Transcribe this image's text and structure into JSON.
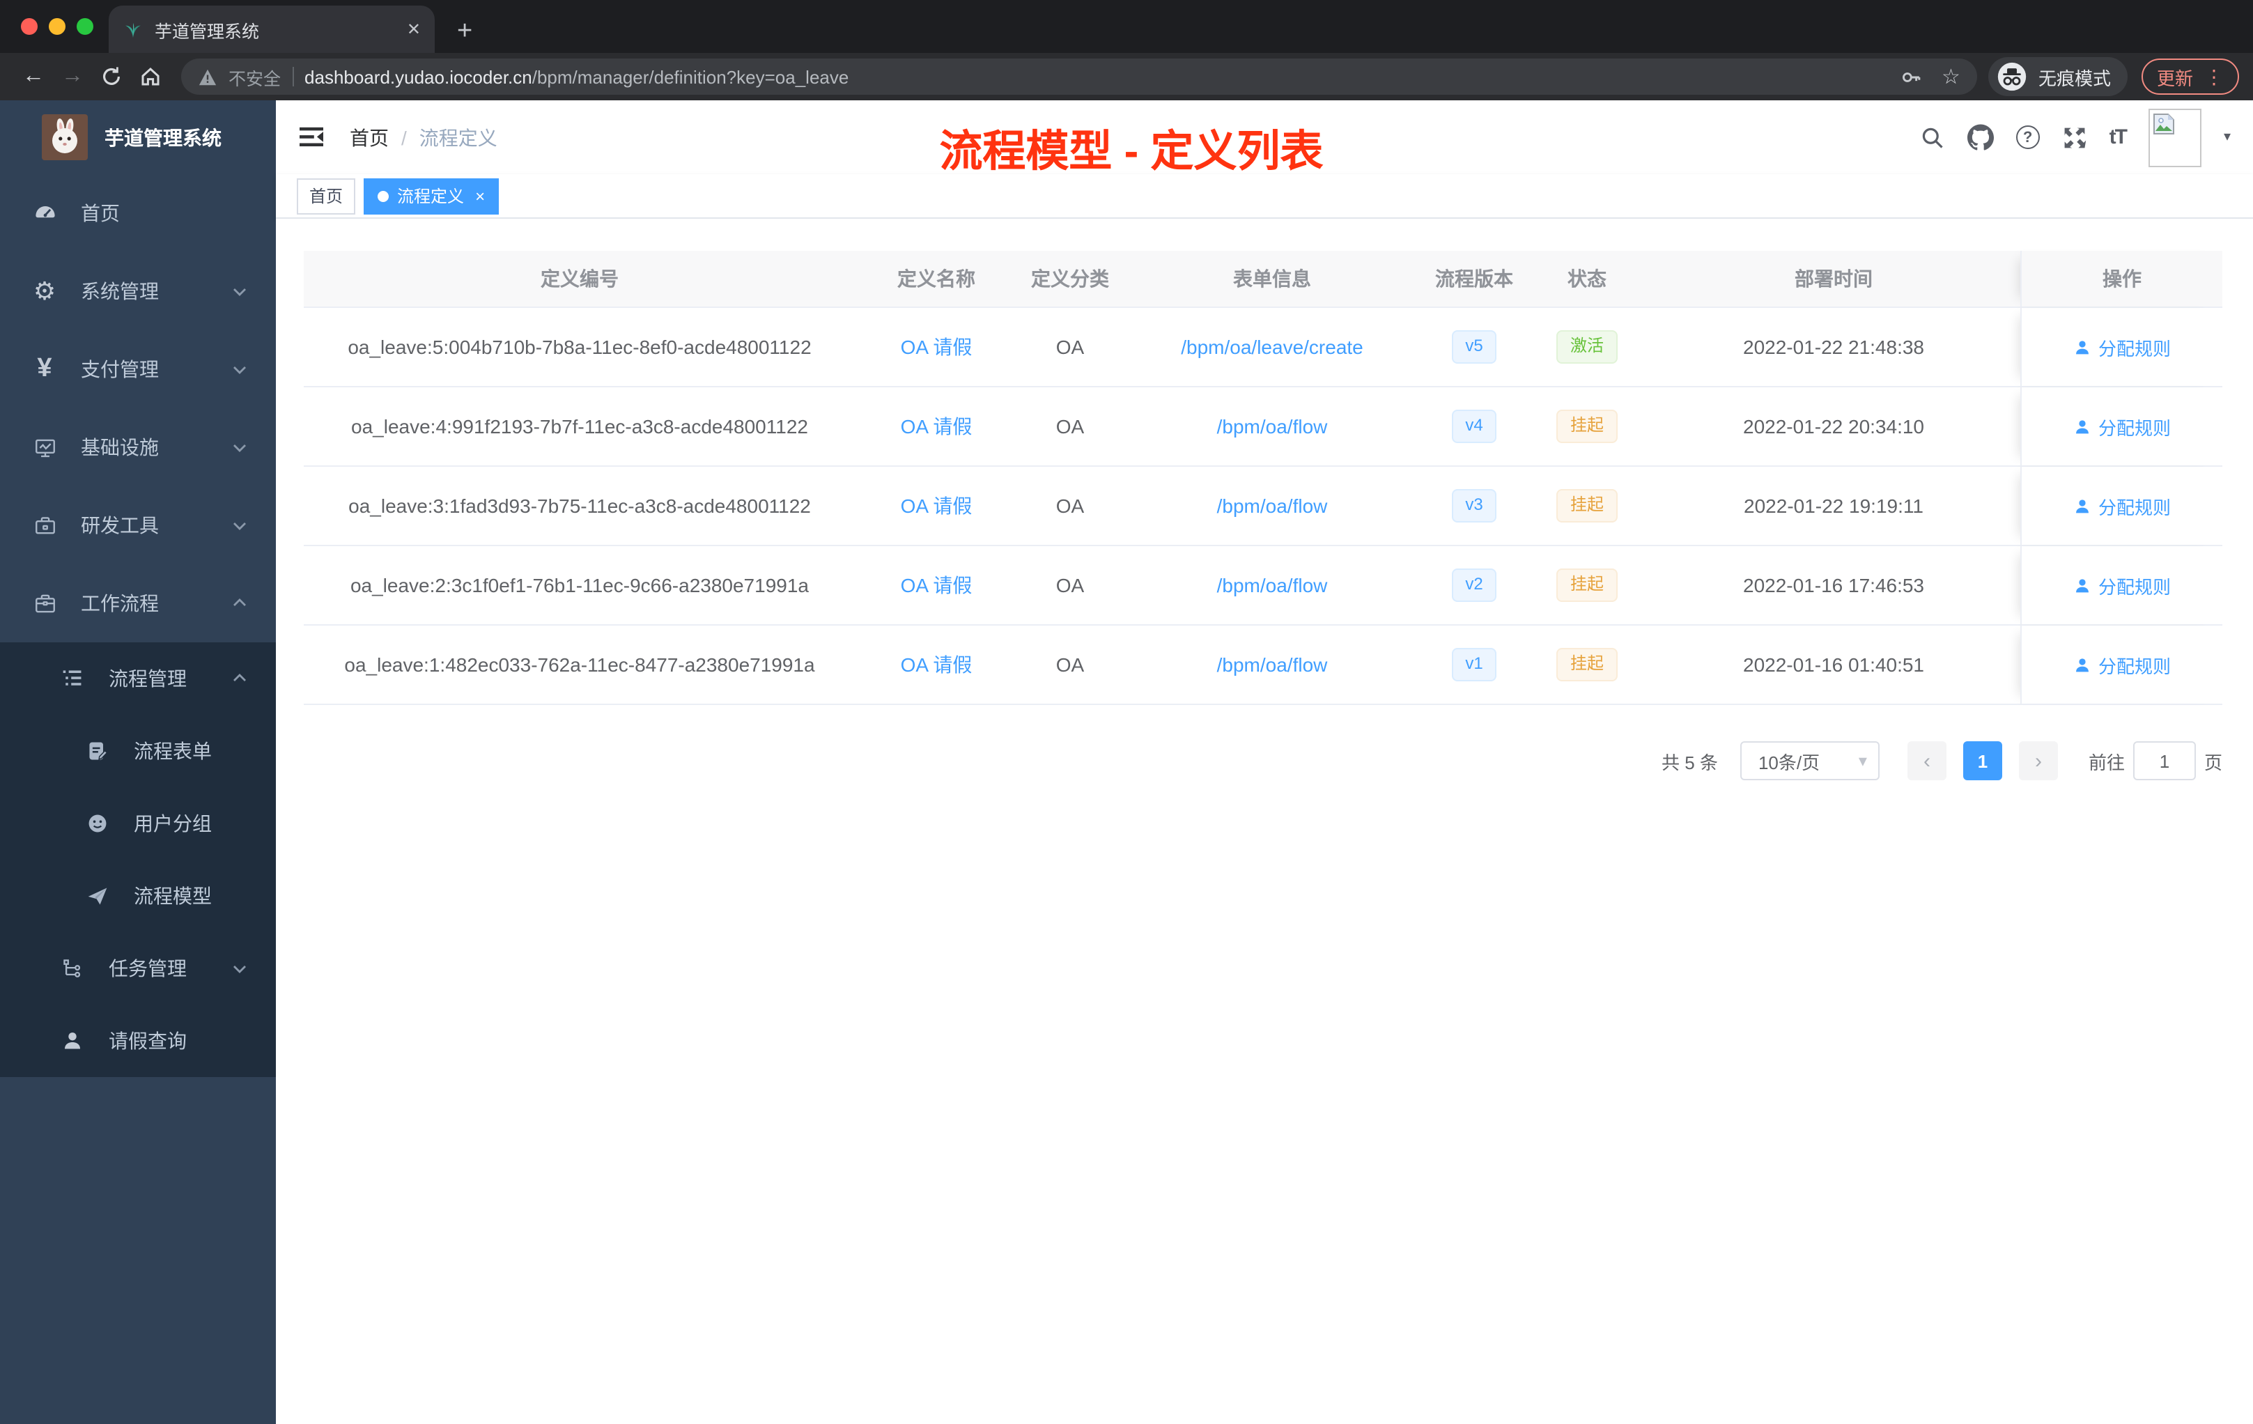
{
  "colors": {
    "accent": "#409eff",
    "annotation": "#ff3310",
    "success": "#67c23a",
    "warning": "#e6a23c",
    "sidebar_bg": "#304156",
    "submenu_bg": "#1f2d3d",
    "update_red": "#f28b82"
  },
  "browser": {
    "tab_title": "芋道管理系统",
    "security_label": "不安全",
    "url_domain": "dashboard.yudao.iocoder.cn",
    "url_path": "/bpm/manager/definition?key=oa_leave",
    "incognito_label": "无痕模式",
    "update_label": "更新"
  },
  "icons": {
    "close": "✕",
    "plus": "+",
    "back": "←",
    "forward": "→",
    "star": "☆",
    "dots": "⋮",
    "gear": "⚙",
    "yen": "¥",
    "question": "?",
    "tT": "tT",
    "caret_down": "▾",
    "chev_up": "︿",
    "chev_down": "﹀",
    "prev": "‹",
    "next": "›",
    "select_caret": "▾",
    "slash": "/",
    "tag_close": "×"
  },
  "sidebar": {
    "app_title": "芋道管理系统",
    "items": [
      {
        "label": "首页"
      },
      {
        "label": "系统管理"
      },
      {
        "label": "支付管理"
      },
      {
        "label": "基础设施"
      },
      {
        "label": "研发工具"
      },
      {
        "label": "工作流程"
      },
      {
        "label": "流程管理"
      },
      {
        "label": "流程表单"
      },
      {
        "label": "用户分组"
      },
      {
        "label": "流程模型"
      },
      {
        "label": "任务管理"
      },
      {
        "label": "请假查询"
      }
    ]
  },
  "header": {
    "breadcrumb_home": "首页",
    "breadcrumb_current": "流程定义",
    "annotation": "流程模型 - 定义列表"
  },
  "tags": {
    "home": "首页",
    "active": "流程定义"
  },
  "table": {
    "columns": [
      "定义编号",
      "定义名称",
      "定义分类",
      "表单信息",
      "流程版本",
      "状态",
      "部署时间",
      "操作"
    ],
    "rows": [
      {
        "id": "oa_leave:5:004b710b-7b8a-11ec-8ef0-acde48001122",
        "name": "OA 请假",
        "category": "OA",
        "form": "/bpm/oa/leave/create",
        "version": "v5",
        "status": "激活",
        "status_type": "success",
        "time": "2022-01-22 21:48:38",
        "action": "分配规则"
      },
      {
        "id": "oa_leave:4:991f2193-7b7f-11ec-a3c8-acde48001122",
        "name": "OA 请假",
        "category": "OA",
        "form": "/bpm/oa/flow",
        "version": "v4",
        "status": "挂起",
        "status_type": "warning",
        "time": "2022-01-22 20:34:10",
        "action": "分配规则"
      },
      {
        "id": "oa_leave:3:1fad3d93-7b75-11ec-a3c8-acde48001122",
        "name": "OA 请假",
        "category": "OA",
        "form": "/bpm/oa/flow",
        "version": "v3",
        "status": "挂起",
        "status_type": "warning",
        "time": "2022-01-22 19:19:11",
        "action": "分配规则"
      },
      {
        "id": "oa_leave:2:3c1f0ef1-76b1-11ec-9c66-a2380e71991a",
        "name": "OA 请假",
        "category": "OA",
        "form": "/bpm/oa/flow",
        "version": "v2",
        "status": "挂起",
        "status_type": "warning",
        "time": "2022-01-16 17:46:53",
        "action": "分配规则"
      },
      {
        "id": "oa_leave:1:482ec033-762a-11ec-8477-a2380e71991a",
        "name": "OA 请假",
        "category": "OA",
        "form": "/bpm/oa/flow",
        "version": "v1",
        "status": "挂起",
        "status_type": "warning",
        "time": "2022-01-16 01:40:51",
        "action": "分配规则"
      }
    ]
  },
  "pagination": {
    "total": "共 5 条",
    "page_size": "10条/页",
    "page": "1",
    "goto_prefix": "前往",
    "goto_value": "1",
    "goto_suffix": "页"
  }
}
